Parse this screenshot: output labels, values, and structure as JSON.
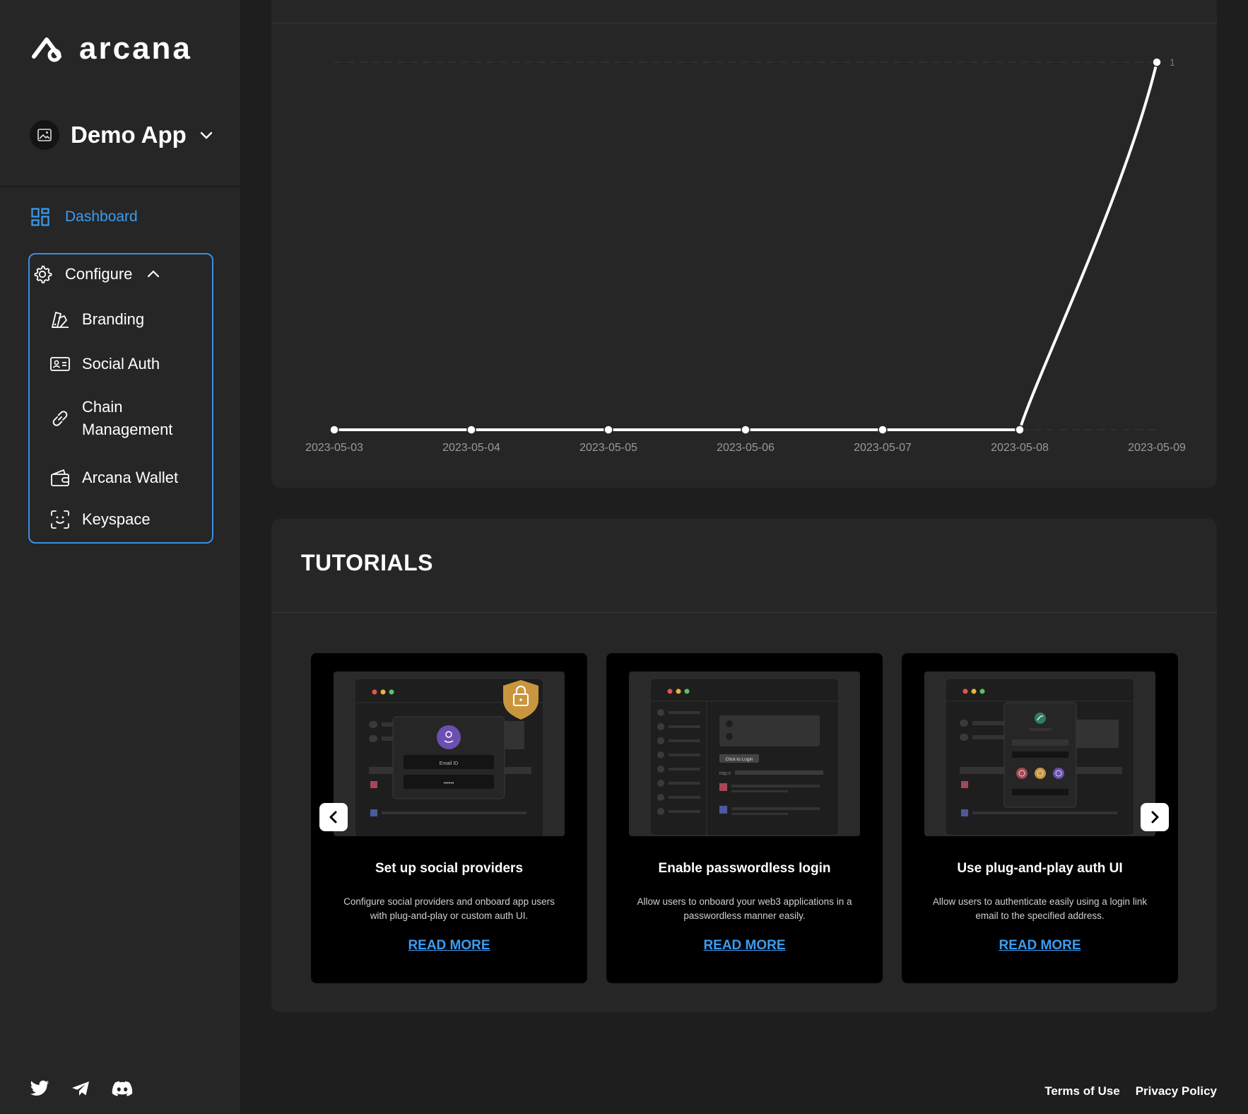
{
  "brand": {
    "name": "arcana"
  },
  "app_switcher": {
    "name": "Demo App"
  },
  "nav": {
    "dashboard": "Dashboard",
    "configure": "Configure",
    "items": [
      {
        "label": "Branding",
        "icon": "branding-icon"
      },
      {
        "label": "Social Auth",
        "icon": "id-card-icon"
      },
      {
        "label": "Chain Management",
        "icon": "link-icon"
      },
      {
        "label": "Arcana Wallet",
        "icon": "wallet-icon"
      },
      {
        "label": "Keyspace",
        "icon": "face-scan-icon"
      }
    ]
  },
  "chart_data": {
    "type": "line",
    "x": [
      "2023-05-03",
      "2023-05-04",
      "2023-05-05",
      "2023-05-06",
      "2023-05-07",
      "2023-05-08",
      "2023-05-09"
    ],
    "values": [
      0,
      0,
      0,
      0,
      0,
      0,
      1
    ],
    "ylim": [
      0,
      1
    ],
    "max_label": "1",
    "line_color": "#ffffff"
  },
  "tutorials": {
    "title": "TUTORIALS",
    "cards": [
      {
        "title": "Set up social providers",
        "desc_line1": "Configure social providers and onboard app users",
        "desc_line2": "with plug-and-play or custom auth UI.",
        "cta": "READ MORE",
        "thumb_email": "Email ID",
        "thumb_pass": "••••••"
      },
      {
        "title": "Enable passwordless login",
        "desc_line1": "Allow users to onboard your web3 applications in a",
        "desc_line2": "passwordless manner easily.",
        "cta": "READ MORE",
        "thumb_btn": "Click to Login",
        "thumb_url": "http://"
      },
      {
        "title": "Use plug-and-play auth UI",
        "desc_line1": "Allow users to authenticate easily using a login link",
        "desc_line2": "email to the specified address.",
        "cta": "READ MORE"
      }
    ]
  },
  "footer": {
    "terms": "Terms of Use",
    "privacy": "Privacy Policy"
  },
  "colors": {
    "accent": "#3b9cf2",
    "sidebar_bg": "#262626",
    "card_bg": "#262626",
    "tutorial_card_bg": "#000000",
    "shield": "#c9963f"
  }
}
